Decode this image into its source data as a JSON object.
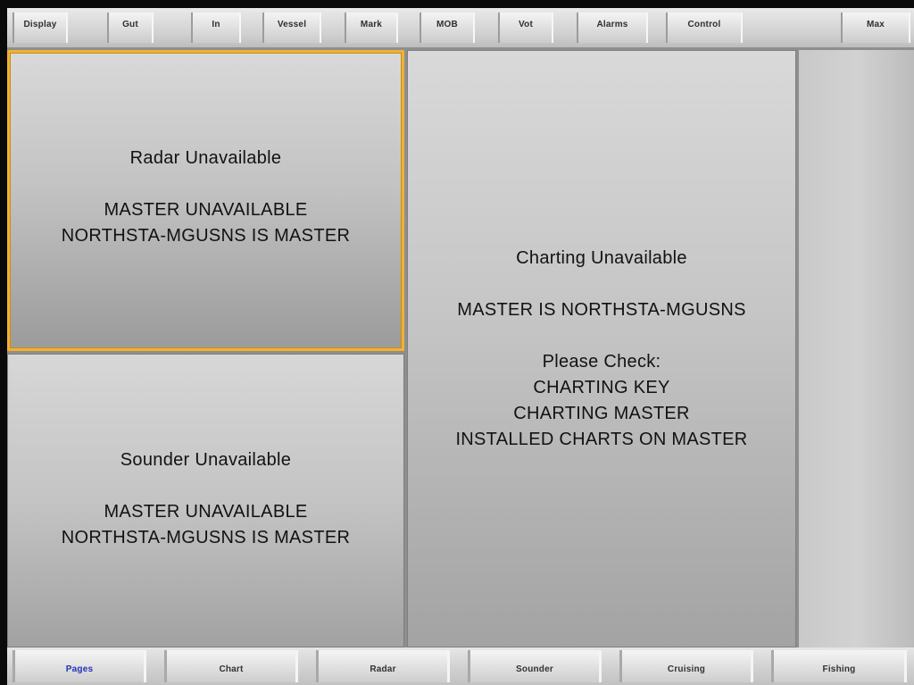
{
  "top_tabs": [
    {
      "label": "Display"
    },
    {
      "label": "Gut"
    },
    {
      "label": "In"
    },
    {
      "label": "Vessel"
    },
    {
      "label": "Mark"
    },
    {
      "label": "MOB"
    },
    {
      "label": "Vot"
    },
    {
      "label": "Alarms"
    },
    {
      "label": "Control"
    },
    {
      "label": "Max"
    }
  ],
  "panes": {
    "radar": {
      "title": "Radar Unavailable",
      "line1": "MASTER UNAVAILABLE",
      "line2": "NORTHSTA-MGUSNS IS MASTER"
    },
    "sounder": {
      "title": "Sounder Unavailable",
      "line1": "MASTER UNAVAILABLE",
      "line2": "NORTHSTA-MGUSNS IS MASTER"
    },
    "charting": {
      "title": "Charting Unavailable",
      "master": "MASTER IS NORTHSTA-MGUSNS",
      "check_heading": "Please Check:",
      "checks": [
        "CHARTING KEY",
        "CHARTING MASTER",
        "INSTALLED CHARTS ON MASTER"
      ]
    }
  },
  "bottom_nav": [
    {
      "label": "Pages",
      "active": true
    },
    {
      "label": "Chart",
      "active": false
    },
    {
      "label": "Radar",
      "active": false
    },
    {
      "label": "Sounder",
      "active": false
    },
    {
      "label": "Cruising",
      "active": false
    },
    {
      "label": "Fishing",
      "active": false
    }
  ],
  "colors": {
    "focus_border": "#f0b234",
    "active_nav_text": "#2432b8"
  }
}
